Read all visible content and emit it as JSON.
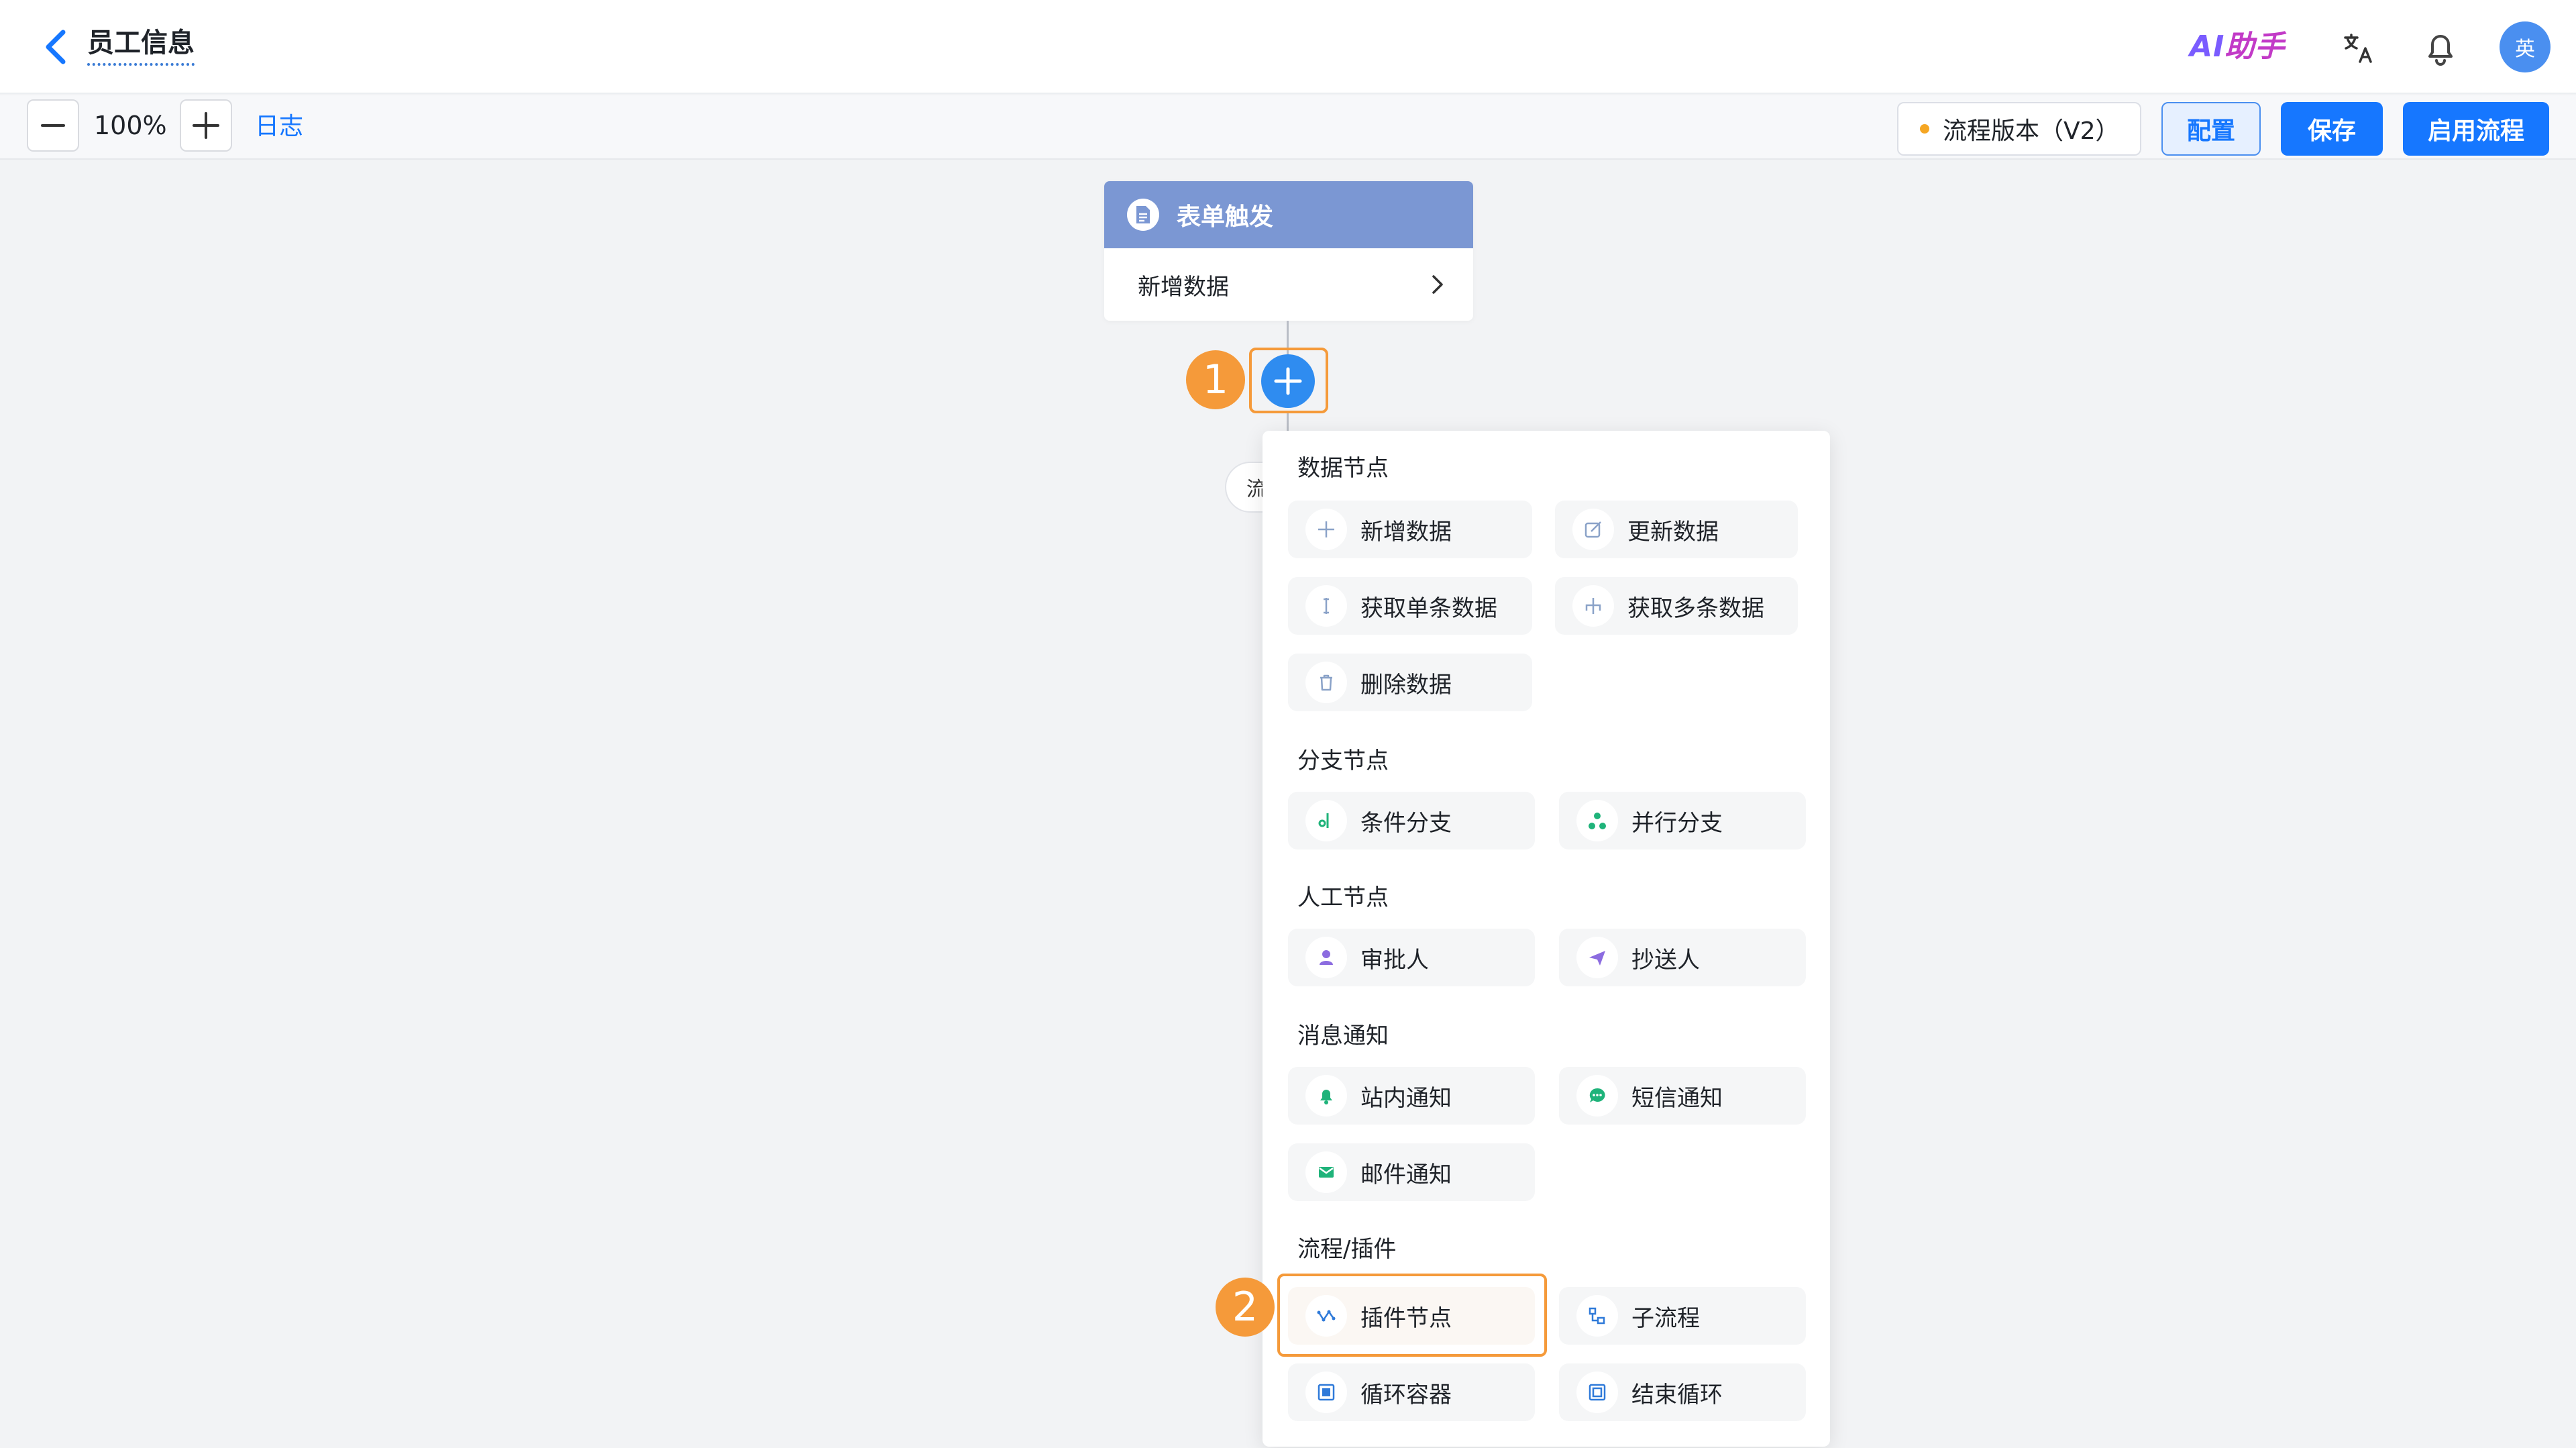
{
  "header": {
    "title": "员工信息",
    "ai_assistant": {
      "ai": "AI",
      "zh": "助手"
    },
    "avatar_text": "英"
  },
  "toolbar": {
    "zoom_level": "100%",
    "log_label": "日志",
    "version_label": "流程版本（V2）",
    "config_label": "配置",
    "save_label": "保存",
    "enable_label": "启用流程"
  },
  "canvas": {
    "trigger_title": "表单触发",
    "trigger_action": "新增数据",
    "step_badges": [
      "1",
      "2"
    ],
    "partial_chip_text": "流"
  },
  "menu": {
    "sections": {
      "data": "数据节点",
      "branch": "分支节点",
      "manual": "人工节点",
      "message": "消息通知",
      "plugin": "流程/插件"
    },
    "items": {
      "add_data": "新增数据",
      "update_data": "更新数据",
      "get_single": "获取单条数据",
      "get_multi": "获取多条数据",
      "delete_data": "删除数据",
      "condition_branch": "条件分支",
      "parallel_branch": "并行分支",
      "approver": "审批人",
      "cc": "抄送人",
      "inbox_notice": "站内通知",
      "sms_notice": "短信通知",
      "email_notice": "邮件通知",
      "plugin_node": "插件节点",
      "sub_process": "子流程",
      "loop_container": "循环容器",
      "end_loop": "结束循环"
    }
  },
  "colors": {
    "primary": "#1677ff",
    "trigger_header": "#7b97d3",
    "highlight": "#f59a3a",
    "green": "#1fb37a",
    "purple": "#8c6ce0"
  }
}
